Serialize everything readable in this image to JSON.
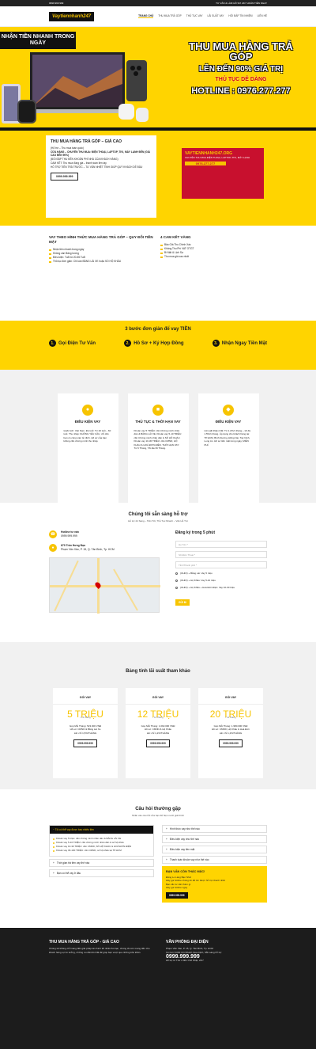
{
  "topbar": {
    "phone": "0999 999 999",
    "hours": "TƯ VẤN & LÀM HỒ SƠ 24/7 HOÀN TIỀN NGAY"
  },
  "nav": {
    "logo": "Vaytiennhanh247",
    "items": [
      {
        "label": "TRANG CHỦ",
        "active": true
      },
      {
        "label": "THU MUA TRẢ GÓP"
      },
      {
        "label": "THỦ TỤC VAY"
      },
      {
        "label": "LÃI SUẤT VAY"
      },
      {
        "label": "HỎI ĐÁP TÍN NHIỆM"
      },
      {
        "label": "LIÊN HỆ"
      }
    ]
  },
  "hero": {
    "badge": "NHẬN TIỀN NHANH TRONG NGÀY",
    "t1": "THU MUA HÀNG TRẢ GÓP",
    "t2": "LÊN ĐẾN 90% GIÁ TRỊ",
    "t3": "THỦ TỤC DỄ DÀNG",
    "t4": "HOTLINE : 0976.277.277"
  },
  "promo": {
    "title": "THU MUA HÀNG TRẢ GÓP – GIÁ CAO",
    "l1": "(Hỗ trợ – Thu mua toàn quốc)",
    "l2": "CỬA HÀNG – CHUYÊN THU MUA: ĐIỆN THOẠI, LAPTOP, TIVI, MÁY LẠNH ĐẾN (GIÁ CAO ĐẾN 90%)",
    "l3": "(BỐI ĐẮP THU ĐẾN KHOẢN PHÍ NHÀ CỦA KHÁCH HÀNG)",
    "l4": "CAM KẾT: Thu mua đúng giá – thanh toán liền tay",
    "l5": "HỖ TRỢ TIỀN TRẢ TRƯỚC – TƯ VẤN NHIỆT TÌNH GIÚP QUÝ KHÁCH DỄ ĐẬU",
    "btn": "0999.999.999",
    "img_title": "VAYTIENNHANH247.ORG",
    "img_sub": "CHUYÊN THU MUA ĐIỆN THOẠI, LAPTOP, TIVI, MÁY LẠNH",
    "img_phone": "0976.277.277"
  },
  "sec2": {
    "left_title": "VAY THEO HÌNH THỨC MUA HÀNG TRẢ GÓP – QUY ĐỔI TIỀN MẶT",
    "left_items": [
      "Nhận tiền nhanh trong ngày",
      "Không cần Bảng lương",
      "Điều kiện: Tuổi từ 20-55 Tuổi",
      "Thủ tục đơn giản: Chỉ cần BẰNG LÁI XE hoặc SỔ HỘ KHẨU"
    ],
    "right_title": "4 CAM KẾT VÀNG",
    "right_items": [
      "Bảo Giá Thu Chính Xác",
      "Không Thu Phí VAT GTGT",
      "Bí Mật & Lịch Sự",
      "Thu mua giá cao nhất"
    ]
  },
  "steps": {
    "title": "3 bước đơn giản để vay TIỀN",
    "items": [
      "Gọi Điện Tư Vấn",
      "Hồ Sơ + Ký Hợp Đồng",
      "Nhận Ngay Tiền Mặt"
    ]
  },
  "cards": [
    {
      "title": "ĐIỀU KIỆN VAY",
      "text": "Quốc tịch: Việt Nam. Độ tuổi: Từ 20 tuổi – 60 tuổi. Thu nhập: KHÔNG YÊU CẦU, chỉ cần bạn có công việc ổn định. Hồ sơ của bạn không cần chứng minh thu nhập."
    },
    {
      "title": "THỦ TỤC & THỜI HẠN VAY",
      "text": "Khoản vay 5 TRIỆU: cần Chứng minh nhân dân & BẰNG LÁI XE. Khoản vay 5-10 TRIỆU: cần Chứng minh nhân dân & SỔ HỘ KHẨU. Khoản vay 10-30 TRIỆU: cần CMND, HỘ KHẨU & HOÁ ĐƠN ĐIỆN. THỜI HẠN VAY: Từ 6 Tháng, Tối Đa 36 Tháng."
    },
    {
      "title": "ĐIỀU KIỆN VAY",
      "text": "Lãi suất thấp nhất: Từ 1.2%/1 tháng – tối đa 1.5%/1 tháng. Áp dụng cho khách hàng tại: TP.HCM, Bình Dương, Đồng Nai, Tây Ninh, Long An. Hồ sơ tiền mặt trong ngày, MIỄN PHÍ."
    }
  ],
  "contact": {
    "title": "Chúng tôi sẵn sàng hỗ trợ",
    "sub": "Hỗ trợ 24 Sáng – Tiền Tốt, Thủ Tục Nhanh – Vấn Hỗ Trợ",
    "hotline_label": "Hotline tư vấn",
    "hotline": "0999.999.999",
    "addr_label": "679 Trần Hưng Đạo",
    "addr": "Phạm Văn Xảo, P. 15, Q. Tân Bình, Tp. HCM",
    "form_title": "Đăng ký trong 5 phút",
    "f1": "Họ Tên *",
    "f2": "Số Điện Thoại *",
    "f3": "Tỉnh/Thành phố *",
    "r1": "(OHIO) + Bằng Lái: Vay 5 triệu",
    "r2": "(OHIO) + Hộ Khẩu: Vay 5-10 triệu",
    "r3": "(OHIO) + Hộ Khẩu + Hoá Đơn Điện: Vay 10-30 triệu",
    "send": "GỬI ĐI"
  },
  "pricing": {
    "title": "Bảng tính lãi suất tham khảo",
    "cards": [
      {
        "h": "GÓI VAY",
        "amt": "5 TRIỆU",
        "term": "/ 12 tháng",
        "a": "Góp Mỗi Tháng: 523.000 VNĐ",
        "b": "Hồ sơ: CMND & Bằng Lái Xe",
        "c": "Lãi: chỉ 1,5%/THÁNG",
        "btn": "0999.999.999"
      },
      {
        "h": "GÓI VAY",
        "amt": "12 TRIỆU",
        "term": "/ 12 tháng",
        "a": "Góp Mỗi Tháng: 1.092.000 VNĐ",
        "b": "Hồ sơ: CMND & Hộ Khẩu",
        "c": "Lãi: chỉ 1,2%/THÁNG",
        "btn": "0999.999.999"
      },
      {
        "h": "GÓI VAY",
        "amt": "20 TRIỆU",
        "term": "/ 12 tháng",
        "a": "Góp Mỗi Tháng: 1.980.000 VNĐ",
        "b": "Hồ sơ: CMND, Hộ Khẩu & Hoá Đơn",
        "c": "Lãi: chỉ 1,2%/THÁNG",
        "btn": "0999.999.999"
      }
    ]
  },
  "faq": {
    "title": "Câu hỏi thường gặp",
    "sub": "Nhấn vào câu hỏi của bạn để hiện ra lời giải thích",
    "open_q": "Tôi có thể vay được bao nhiêu tiền",
    "open_a": [
      "Khoản vay 5 triệu: cần chứng minh nhân dân & BẰNG LÁI XE",
      "Khoản vay 5-10 TRIỆU: cần chứng minh nhân dân & sổ hộ khẩu",
      "Khoản vay 10-30 TRIỆU: cần CMND, SỔ HỘ KHẨU & HOÁ ĐƠN ĐIỆN",
      "Khoản vay 30-100 TRIỆU: cần CMND, sổ hộ khẩu tại TP.HCM"
    ],
    "q_left": [
      "Thời gian trả tiền vay thế nào",
      "Bạn có thể vay ở đâu"
    ],
    "q_right": [
      "Hình thức vay như thế nào",
      "Điều kiện vay như thế nào",
      "Điều kiện vay tiền mặt",
      "Thanh toán khoản vay như thế nào"
    ],
    "box_title": "BẠN VẪN CÒN THẮC MẮC!",
    "box_items": [
      "Đăng Lo Láng Bạn Nhé!",
      "Hãy gọi hotline chúng tôi để tìm được hỗ trợ nhanh nhất",
      "Bạn cần tư vấn thêm gì",
      "Hãy gọi hotline ngay"
    ],
    "box_btn": "0999.999.999"
  },
  "footer": {
    "t1": "THU MUA HÀNG TRẢ GÓP - GIÁ CAO",
    "d1": "Chúng tôi không chỉ mang đến giải pháp tài chính tốt nhất cho bạn, chúng tôi còn mang đến cho khách hàng sự tin tưởng, những ưu đãi tốt nhất để giúp bạn vượt qua những khó khăn.",
    "t2": "VĂN PHÒNG ĐẠI DIỆN",
    "d2": "Phạm Văn Xảo, P. 15, Q. Tân Bình, Tp. HCM",
    "d3": "Có hơn 8.000 Chi Nhánh Giao Dịch, Sẵn sàng hỗ trợ",
    "phone": "0999.999.999",
    "d4": "Hỗ trợ từ Thứ 2 đến Chủ Nhật, 24/7"
  }
}
